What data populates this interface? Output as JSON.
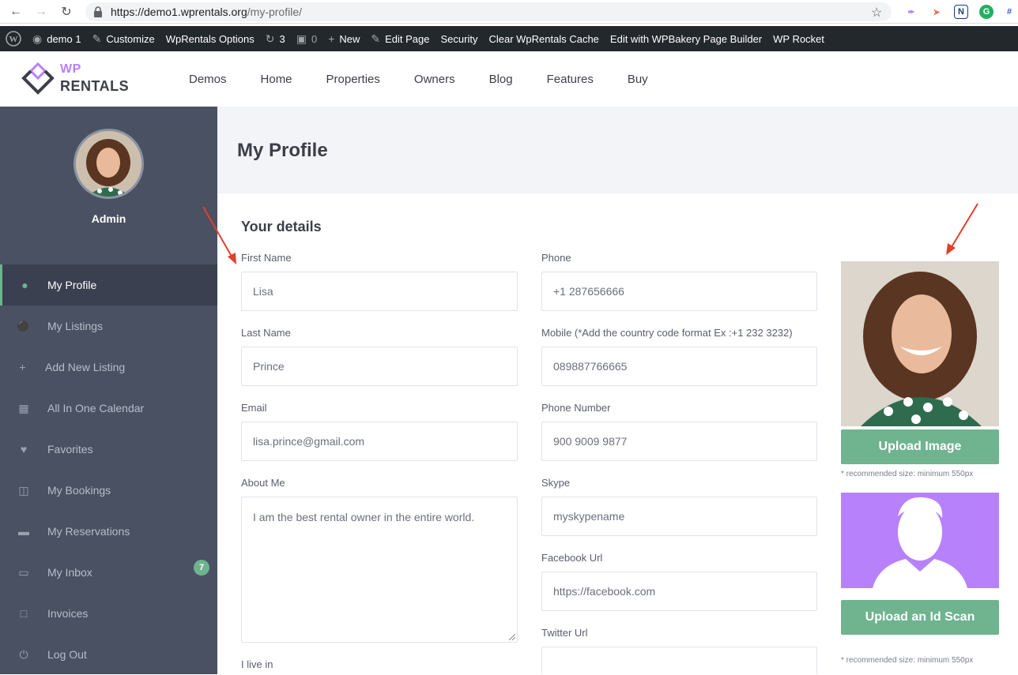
{
  "browser": {
    "url_host": "https://demo1.wprentals.org",
    "url_path": "/my-profile/"
  },
  "adminbar": {
    "site": "demo 1",
    "customize": "Customize",
    "options": "WpRentals Options",
    "updates": "3",
    "comments": "0",
    "new": "New",
    "edit_page": "Edit Page",
    "security": "Security",
    "clear_cache": "Clear WpRentals Cache",
    "wpbakery": "Edit with WPBakery Page Builder",
    "rocket": "WP Rocket"
  },
  "header": {
    "logo_top": "WP",
    "logo_bottom": "RENTALS",
    "nav": [
      "Demos",
      "Home",
      "Properties",
      "Owners",
      "Blog",
      "Features",
      "Buy"
    ]
  },
  "sidebar": {
    "user": "Admin",
    "items": [
      {
        "label": "My Profile",
        "icon": "user-icon"
      },
      {
        "label": "My Listings",
        "icon": "map-pin-icon"
      },
      {
        "label": "Add New Listing",
        "icon": "plus-icon"
      },
      {
        "label": "All In One Calendar",
        "icon": "calendar-icon"
      },
      {
        "label": "Favorites",
        "icon": "heart-icon"
      },
      {
        "label": "My Bookings",
        "icon": "folder-open-icon"
      },
      {
        "label": "My Reservations",
        "icon": "folder-icon"
      },
      {
        "label": "My Inbox",
        "icon": "inbox-icon",
        "badge": "7"
      },
      {
        "label": "Invoices",
        "icon": "file-icon"
      },
      {
        "label": "Log Out",
        "icon": "power-icon"
      }
    ]
  },
  "page": {
    "title": "My Profile",
    "section": "Your details"
  },
  "form": {
    "first_name": {
      "label": "First Name",
      "value": "Lisa"
    },
    "last_name": {
      "label": "Last Name",
      "value": "Prince"
    },
    "email": {
      "label": "Email",
      "value": "lisa.prince@gmail.com"
    },
    "about": {
      "label": "About Me",
      "value": "I am the best rental owner in the entire world."
    },
    "live_in": {
      "label": "I live in"
    },
    "phone": {
      "label": "Phone",
      "value": "+1 287656666"
    },
    "mobile": {
      "label": "Mobile (*Add the country code format Ex :+1 232 3232)",
      "value": "089887766665"
    },
    "phone_number": {
      "label": "Phone Number",
      "value": "900 9009 9877"
    },
    "skype": {
      "label": "Skype",
      "value": "myskypename"
    },
    "facebook": {
      "label": "Facebook Url",
      "value": "https://facebook.com"
    },
    "twitter": {
      "label": "Twitter Url",
      "value": ""
    }
  },
  "uploads": {
    "image_button": "Upload Image",
    "image_note": "* recommended size: minimum 550px",
    "id_button": "Upload an Id Scan",
    "id_note": "* recommended size: minimum 550px"
  },
  "colors": {
    "accent_green": "#6fb38f",
    "accent_purple": "#b881fc",
    "sidebar_bg": "#4a5163",
    "adminbar_bg": "#23282d"
  }
}
